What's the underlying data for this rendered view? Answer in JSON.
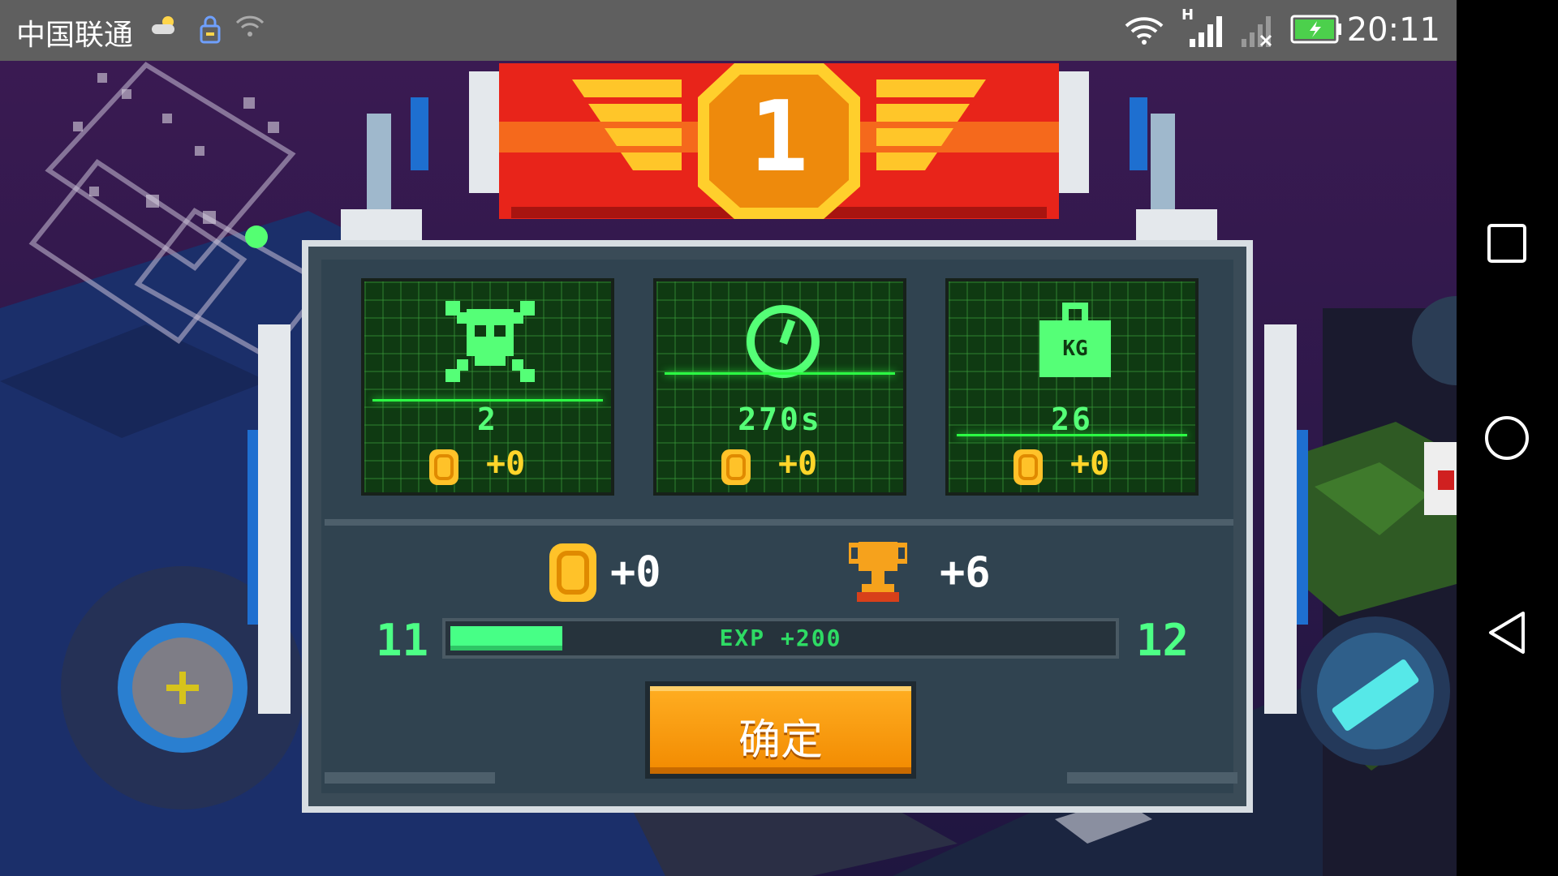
{
  "statusbar": {
    "carrier": "中国联通",
    "network_type": "H",
    "time": "20:11"
  },
  "results": {
    "rank": "1",
    "stats": [
      {
        "icon": "skull-crossbones-icon",
        "value": "2",
        "coin_bonus": "+0"
      },
      {
        "icon": "clock-icon",
        "value": "270s",
        "coin_bonus": "+0"
      },
      {
        "icon": "weight-kg-icon",
        "icon_text": "KG",
        "value": "26",
        "coin_bonus": "+0"
      }
    ],
    "reward_coins": "+0",
    "reward_trophies": "+6",
    "level_current": "11",
    "level_next": "12",
    "exp_label": "EXP +200",
    "exp_progress": 0.17,
    "confirm_label": "确定"
  },
  "colors": {
    "panel": "#304350",
    "stat_green": "#55ff77",
    "coin_gold": "#ffd52a",
    "confirm_orange": "#f59400",
    "banner_red": "#e8241a"
  },
  "controls": {
    "left_joystick_icon": "plus-icon",
    "right_button_icon": "energy-cell-icon"
  }
}
